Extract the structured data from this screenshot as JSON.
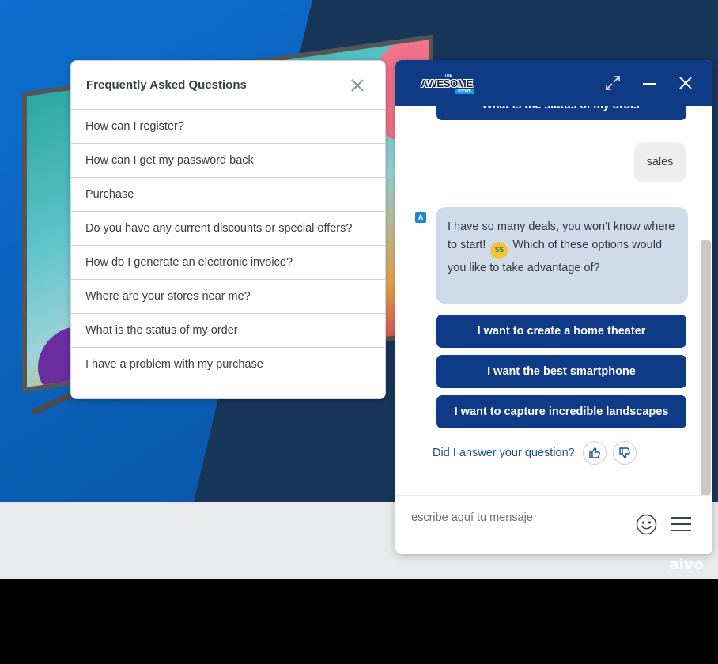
{
  "faq": {
    "title": "Frequently Asked Questions",
    "items": [
      "How can I register?",
      "How can I get my password back",
      "Purchase",
      "Do you have any current discounts or special offers?",
      "How do I generate an electronic invoice?",
      "Where are your stores near me?",
      "What is the status of my order",
      "I have a problem with my purchase"
    ]
  },
  "chat": {
    "brand": {
      "the": "THE",
      "name": "AWESOME",
      "store": "STORE"
    },
    "cut_off_button": "What is the status of my order",
    "user_message": "sales",
    "bot_avatar_letter": "A",
    "bot_message_part1": "I have so many deals, you won't know where to start!",
    "bot_message_emoji": "$$",
    "bot_message_part2": "Which of these options would you like to take advantage of?",
    "options": [
      "I want to create a home theater",
      "I want the best smartphone",
      "I want to capture incredible landscapes"
    ],
    "feedback_question": "Did I answer your question?",
    "composer_placeholder": "escribe aquí tu mensaje"
  },
  "footer_brand": "aivo",
  "colors": {
    "header_bg": "#0e3a86",
    "button_bg": "#0e3a86",
    "bot_bubble": "#cfdbea",
    "user_bubble": "#eeeeee",
    "feedback_text": "#1b4e9a"
  }
}
